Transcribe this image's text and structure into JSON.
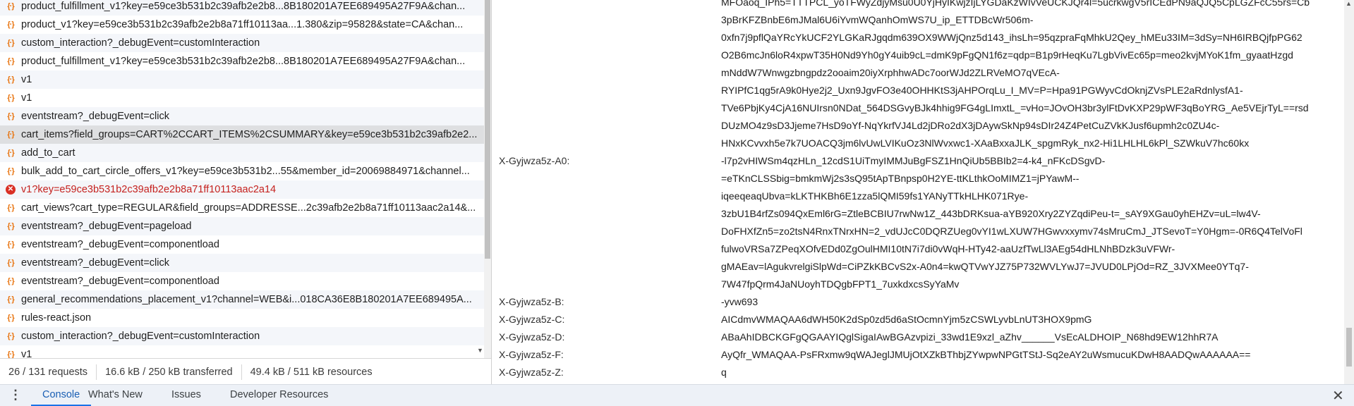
{
  "requests": [
    {
      "name": "product_fulfillment_v1?key=e59ce3b531b2c39afb2e2b8...8B180201A7EE689495A27F9A&chan...",
      "icon": "fetch-icon",
      "status": "ok"
    },
    {
      "name": "product_v1?key=e59ce3b531b2c39afb2e2b8a71ff10113aa...1.380&zip=95828&state=CA&chan...",
      "icon": "fetch-icon",
      "status": "ok"
    },
    {
      "name": "custom_interaction?_debugEvent=customInteraction",
      "icon": "fetch-icon",
      "status": "ok"
    },
    {
      "name": "product_fulfillment_v1?key=e59ce3b531b2c39afb2e2b8...8B180201A7EE689495A27F9A&chan...",
      "icon": "fetch-icon",
      "status": "ok"
    },
    {
      "name": "v1",
      "icon": "fetch-icon",
      "status": "ok"
    },
    {
      "name": "v1",
      "icon": "fetch-icon",
      "status": "ok"
    },
    {
      "name": "eventstream?_debugEvent=click",
      "icon": "fetch-icon",
      "status": "ok"
    },
    {
      "name": "cart_items?field_groups=CART%2CCART_ITEMS%2CSUMMARY&key=e59ce3b531b2c39afb2e2...",
      "icon": "fetch-icon",
      "status": "ok",
      "selected": true
    },
    {
      "name": "add_to_cart",
      "icon": "fetch-icon",
      "status": "ok"
    },
    {
      "name": "bulk_add_to_cart_circle_offers_v1?key=e59ce3b531b2...55&member_id=20069884971&channel...",
      "icon": "fetch-icon",
      "status": "ok"
    },
    {
      "name": "v1?key=e59ce3b531b2c39afb2e2b8a71ff10113aac2a14",
      "icon": "error-icon",
      "status": "error"
    },
    {
      "name": "cart_views?cart_type=REGULAR&field_groups=ADDRESSE...2c39afb2e2b8a71ff10113aac2a14&...",
      "icon": "fetch-icon",
      "status": "ok"
    },
    {
      "name": "eventstream?_debugEvent=pageload",
      "icon": "fetch-icon",
      "status": "ok"
    },
    {
      "name": "eventstream?_debugEvent=componentload",
      "icon": "fetch-icon",
      "status": "ok"
    },
    {
      "name": "eventstream?_debugEvent=click",
      "icon": "fetch-icon",
      "status": "ok"
    },
    {
      "name": "eventstream?_debugEvent=componentload",
      "icon": "fetch-icon",
      "status": "ok"
    },
    {
      "name": "general_recommendations_placement_v1?channel=WEB&i...018CA36E8B180201A7EE689495A...",
      "icon": "fetch-icon",
      "status": "ok"
    },
    {
      "name": "rules-react.json",
      "icon": "fetch-icon",
      "status": "ok"
    },
    {
      "name": "custom_interaction?_debugEvent=customInteraction",
      "icon": "fetch-icon",
      "status": "ok"
    },
    {
      "name": "v1",
      "icon": "fetch-icon",
      "status": "ok"
    }
  ],
  "status_bar": {
    "requests": "26 / 131 requests",
    "transferred": "16.6 kB / 250 kB transferred",
    "resources": "49.4 kB / 511 kB resources"
  },
  "headers": [
    {
      "name": "",
      "lines": [
        "MFOaoq_IPh5=TTTPCL_yoTFWyZdjyMsu0U0YjHyIKwjzIjLYGDaKzWIvVeUCKJQr4l=5ucrkwgV5rICEdPN9aQJQ5CpLGZFcC55rs=Cb",
        "3pBrKFZBnbE6mJMal6U6iYvmWQanhOmWS7U_ip_ETTDBcWr506m-",
        "0xfn7j9pflQaYRcYkUCF2YLGKaRJgqdm639OX9WWjQnz5d143_ihsLh=95qzpraFqMhkU2Qey_hMEu33IM=3dSy=NH6IRBQjfpPG62",
        "O2B6mcJn6loR4xpwT35H0Nd9Yh0gY4uib9cL=dmK9pFgQN1f6z=qdp=B1p9rHeqKu7LgbVivEc65p=meo2kvjMYoK1fm_gyaatHzgd",
        "mNddW7Wnwgzbngpdz2ooaim20iyXrphhwADc7oorWJd2ZLRVeMO7qVEcA-",
        "RYIPfC1qg5rA9k0Hye2j2_Uxn9JgvFO3e40OHHKtS3jAHPOrqLu_I_MV=P=Hpa91PGWyvCdOknjZVsPLE2aRdnlysfA1-",
        "TVe6PbjKy4CjA16NUIrsn0NDat_564DSGvyBJk4hhig9FG4gLImxtL_=vHo=JOvOH3br3ylFtDvKXP29pWF3qBoYRG_Ae5VEjrTyL==rsd",
        "DUzMO4z9sD3Jjeme7HsD9oYf-NqYkrfVJ4Ld2jDRo2dX3jDAywSkNp94sDIr24Z4PetCuZVkKJusf6upmh2c0ZU4c-",
        "HNxKCvvxh5e7k7UOACQ3jm6lvUwLVIKuOz3NlWvxwc1-XAaBxxaJLK_spgmRyk_nx2-Hi1LHLHL6kPl_SZWkuV7hc60kx"
      ]
    },
    {
      "name": "X-Gyjwza5z-A0:",
      "lines": [
        "-l7p2vHIWSm4qzHLn_12cdS1UiTmyIMMJuBgFSZ1HnQiUb5BBIb2=4-k4_nFKcDSgvD-",
        "=eTKnCLSSbig=bmkmWj2s3sQ95tApTBnpsp0H2YE-ttKLthkOoMIMZ1=jPYawM--",
        "iqeeqeaqUbva=kLKTHKBh6E1zza5lQMI59fs1YANyTTkHLHK071Rye-",
        "3zbU1B4rfZs094QxEml6rG=ZtleBCBIU7rwNw1Z_443bDRKsua-aYB920Xry2ZYZqdiPeu-t=_sAY9XGau0yhEHZv=uL=lw4V-",
        "DoFHXfZn5=zo2tsN4RnxTNrxHN=2_vdUJcC0DQRZUeg0vYI1wLXUW7HGwvxxymv74sMruCmJ_JTSevoT=Y0Hgm=-0R6Q4TelVoFl",
        "fulwoVRSa7ZPeqXOfvEDd0ZgOulHMI10tN7i7di0vWqH-HTy42-aaUzfTwLl3AEg54dHLNhBDzk3uVFWr-",
        "gMAEav=lAgukvrelgiSlpWd=CiPZkKBCvS2x-A0n4=kwQTVwYJZ75P732WVLYwJ7=JVUD0LPjOd=RZ_3JVXMee0YTq7-",
        "7W47fpQrm4JaNUoyhTDQgbFPT1_7uxkdxcsSyYaMv"
      ]
    },
    {
      "name": "X-Gyjwza5z-B:",
      "lines": [
        "-yvw693"
      ]
    },
    {
      "name": "X-Gyjwza5z-C:",
      "lines": [
        "AICdmvWMAQAA6dWH50K2dSp0zd5d6aStOcmnYjm5zCSWLyvbLnUT3HOX9pmG"
      ]
    },
    {
      "name": "X-Gyjwza5z-D:",
      "lines": [
        "ABaAhIDBCKGFgQGAAYIQglSigaIAwBGAzvpizi_33wd1E9xzl_aZhv______VsEcALDHOIP_N68hd9EW12hhR7A"
      ]
    },
    {
      "name": "X-Gyjwza5z-F:",
      "lines": [
        "AyQfr_WMAQAA-PsFRxmw9qWAJeglJMUjOtXZkBThbjZYwpwNPGtTStJ-Sq2eAY2uWsmucuKDwH8AADQwAAAAAA=="
      ]
    },
    {
      "name": "X-Gyjwza5z-Z:",
      "lines": [
        "q"
      ]
    }
  ],
  "drawer": {
    "tabs": [
      {
        "label": "Console",
        "active": true
      },
      {
        "label": "What's New",
        "active": false
      },
      {
        "label": "Issues",
        "active": false
      },
      {
        "label": "Developer Resources",
        "active": false
      }
    ],
    "menu_icon": "kebab-menu-icon",
    "close_icon": "close-icon"
  },
  "colors": {
    "fetch_icon": "#e8710a",
    "error": "#d93025",
    "accent": "#1a73e8",
    "selected_row": "#dedfe1"
  }
}
